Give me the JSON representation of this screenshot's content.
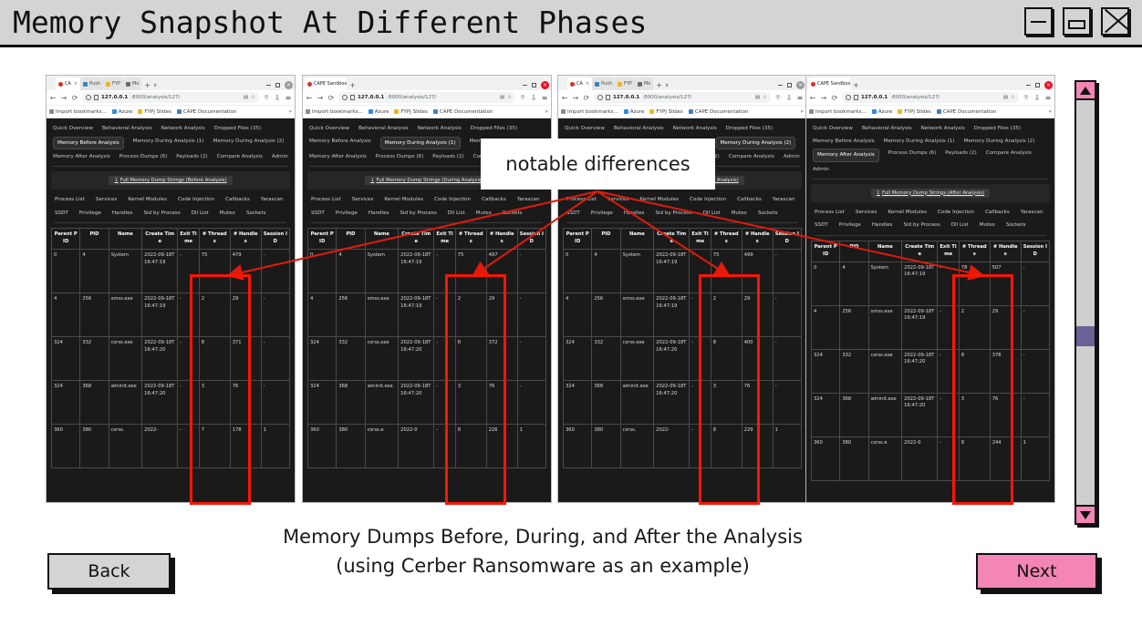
{
  "window": {
    "title": "Memory Snapshot At Different Phases",
    "controls": {
      "minimize": "minimize-icon",
      "maximize": "maximize-icon",
      "close": "close-icon"
    }
  },
  "callout": {
    "text": "notable differences"
  },
  "caption": {
    "line1": "Memory Dumps Before, During, and After the Analysis",
    "line2": "(using Cerber Ransomware as an example)"
  },
  "footer": {
    "back_label": "Back",
    "next_label": "Next",
    "back_color": "#d4d4d4",
    "next_color": "#f386b4"
  },
  "scrollbar": {
    "up_icon": "triangle-up-icon",
    "down_icon": "triangle-down-icon",
    "arrow_color": "#f386b4",
    "thumb_color": "#6a6196"
  },
  "browser_common": {
    "url": "127.0.0.1:8000/analysis/127/",
    "url_host": "127.0.0.1",
    "url_path": ":8000/analysis/127/",
    "bookmarks": [
      {
        "label": "Import bookmarks...",
        "icon": "import-bookmarks-icon"
      },
      {
        "label": "Azure",
        "icon": "azure-icon"
      },
      {
        "label": "FYPJ Slides",
        "icon": "folder-icon"
      },
      {
        "label": "CAPE Documentation",
        "icon": "cape-doc-icon"
      }
    ],
    "bookmarks_overflow": "»",
    "back_icon": "back-arrow-icon",
    "forward_icon": "forward-arrow-icon",
    "reload_icon": "reload-icon",
    "shield_icon": "shield-icon",
    "page_icon": "page-icon",
    "reader_icon": "reader-icon",
    "bookmark_star_icon": "star-icon",
    "pocket_icon": "pocket-icon",
    "downloads_icon": "downloads-icon",
    "menu_icon": "hamburger-menu-icon",
    "new_tab_icon": "new-tab-icon",
    "tab_list_icon": "chevron-down-icon",
    "tab_close_icon": "close-icon",
    "nav_primary": [
      "Quick Overview",
      "Behavioral Analysis",
      "Network Analysis",
      "Dropped Files (35)",
      "Memory Before Analysis",
      "Memory During Analysis (1)",
      "Memory During Analysis (2)",
      "Memory After Analysis",
      "Process Dumps (6)",
      "Payloads (2)",
      "Compare Analysis",
      "Admin"
    ],
    "subnav": [
      "Process List",
      "Services",
      "Kernel Modules",
      "Code Injection",
      "Callbacks",
      "Yarascan",
      "SSDT",
      "Privilege",
      "Handles",
      "Sid by Process",
      "Dll List",
      "Mutex",
      "Sockets"
    ],
    "table_headers": [
      "Parent PID",
      "PID",
      "Name",
      "Create Time",
      "Exit Time",
      "# Threads",
      "# Handles",
      "Session ID"
    ]
  },
  "windows": [
    {
      "id": "win1",
      "tab_mode": "multi",
      "tabs": [
        {
          "label": "CA",
          "icon": "cape-favicon",
          "active": true
        },
        {
          "label": "Push",
          "icon": "push-favicon",
          "active": false
        },
        {
          "label": "FYP",
          "icon": "fypj-favicon",
          "active": false
        },
        {
          "label": "Mo",
          "icon": "mo-favicon",
          "active": false
        }
      ],
      "selected_nav": "Memory Before Analysis",
      "dump_button": "Full Memory Dump Strings (Before Analysis)",
      "rows": [
        {
          "ppid": "0",
          "pid": "4",
          "name": "System",
          "create": "2022-09-18T16:47:19",
          "exit": "-",
          "threads": "75",
          "handles": "479",
          "session": "-"
        },
        {
          "ppid": "4",
          "pid": "256",
          "name": "smss.exe",
          "create": "2022-09-18T16:47:19",
          "exit": "-",
          "threads": "2",
          "handles": "29",
          "session": "-"
        },
        {
          "ppid": "324",
          "pid": "332",
          "name": "csrss.exe",
          "create": "2022-09-18T16:47:20",
          "exit": "-",
          "threads": "8",
          "handles": "371",
          "session": "-"
        },
        {
          "ppid": "324",
          "pid": "368",
          "name": "wininit.exe",
          "create": "2022-09-18T16:47:20",
          "exit": "-",
          "threads": "3",
          "handles": "76",
          "session": "-"
        },
        {
          "ppid": "360",
          "pid": "380",
          "name": "csrss.",
          "create": "2022-",
          "exit": "-",
          "threads": "7",
          "handles": "178",
          "session": "1"
        }
      ]
    },
    {
      "id": "win2",
      "tab_mode": "single",
      "tabs": [
        {
          "label": "CAPE Sandbox",
          "icon": "cape-favicon",
          "active": true
        }
      ],
      "selected_nav": "Memory During Analysis (1)",
      "dump_button": "Full Memory Dump Strings (During Analysis)",
      "rows": [
        {
          "ppid": "0",
          "pid": "4",
          "name": "System",
          "create": "2022-09-18T16:47:19",
          "exit": "-",
          "threads": "75",
          "handles": "497",
          "session": "-"
        },
        {
          "ppid": "4",
          "pid": "256",
          "name": "smss.exe",
          "create": "2022-09-18T16:47:19",
          "exit": "-",
          "threads": "2",
          "handles": "29",
          "session": "-"
        },
        {
          "ppid": "324",
          "pid": "332",
          "name": "csrss.exe",
          "create": "2022-09-18T16:47:20",
          "exit": "-",
          "threads": "8",
          "handles": "372",
          "session": "-"
        },
        {
          "ppid": "324",
          "pid": "368",
          "name": "wininit.exe",
          "create": "2022-09-18T16:47:20",
          "exit": "-",
          "threads": "3",
          "handles": "76",
          "session": "-"
        },
        {
          "ppid": "360",
          "pid": "380",
          "name": "csrss.e",
          "create": "2022-0",
          "exit": "-",
          "threads": "8",
          "handles": "226",
          "session": "1"
        }
      ]
    },
    {
      "id": "win3",
      "tab_mode": "multi",
      "tabs": [
        {
          "label": "CA",
          "icon": "cape-favicon",
          "active": true
        },
        {
          "label": "Push",
          "icon": "push-favicon",
          "active": false
        },
        {
          "label": "FYP",
          "icon": "fypj-favicon",
          "active": false
        },
        {
          "label": "Mo",
          "icon": "mo-favicon",
          "active": false
        }
      ],
      "selected_nav": "Memory During Analysis (2)",
      "dump_button": "Full Memory Dump Strings (During Analysis)",
      "rows": [
        {
          "ppid": "0",
          "pid": "4",
          "name": "System",
          "create": "2022-09-18T16:47:19",
          "exit": "-",
          "threads": "75",
          "handles": "499",
          "session": "-"
        },
        {
          "ppid": "4",
          "pid": "256",
          "name": "smss.exe",
          "create": "2022-09-18T16:47:19",
          "exit": "-",
          "threads": "2",
          "handles": "29",
          "session": "-"
        },
        {
          "ppid": "324",
          "pid": "332",
          "name": "csrss.exe",
          "create": "2022-09-18T16:47:20",
          "exit": "-",
          "threads": "8",
          "handles": "400",
          "session": "-"
        },
        {
          "ppid": "324",
          "pid": "368",
          "name": "wininit.exe",
          "create": "2022-09-18T16:47:20",
          "exit": "-",
          "threads": "3",
          "handles": "76",
          "session": "-"
        },
        {
          "ppid": "360",
          "pid": "380",
          "name": "csrss.",
          "create": "2022-",
          "exit": "-",
          "threads": "8",
          "handles": "229",
          "session": "1"
        }
      ]
    },
    {
      "id": "win4",
      "tab_mode": "single",
      "tabs": [
        {
          "label": "CAPE Sandbox",
          "icon": "cape-favicon",
          "active": true
        }
      ],
      "selected_nav": "Memory After Analysis",
      "dump_button": "Full Memory Dump Strings (After Analysis)",
      "rows": [
        {
          "ppid": "0",
          "pid": "4",
          "name": "System",
          "create": "2022-09-18T16:47:19",
          "exit": "-",
          "threads": "78",
          "handles": "507",
          "session": "-"
        },
        {
          "ppid": "4",
          "pid": "256",
          "name": "smss.exe",
          "create": "2022-09-18T16:47:19",
          "exit": "-",
          "threads": "2",
          "handles": "29",
          "session": "-"
        },
        {
          "ppid": "324",
          "pid": "332",
          "name": "csrss.exe",
          "create": "2022-09-18T16:47:20",
          "exit": "-",
          "threads": "8",
          "handles": "378",
          "session": "-"
        },
        {
          "ppid": "324",
          "pid": "368",
          "name": "wininit.exe",
          "create": "2022-09-18T16:47:20",
          "exit": "-",
          "threads": "3",
          "handles": "76",
          "session": "-"
        },
        {
          "ppid": "360",
          "pid": "380",
          "name": "csrss.e",
          "create": "2022-0",
          "exit": "-",
          "threads": "8",
          "handles": "244",
          "session": "1"
        }
      ]
    }
  ],
  "annotation": {
    "highlight_color": "#f81606",
    "arrow_color": "#e01b0c"
  }
}
